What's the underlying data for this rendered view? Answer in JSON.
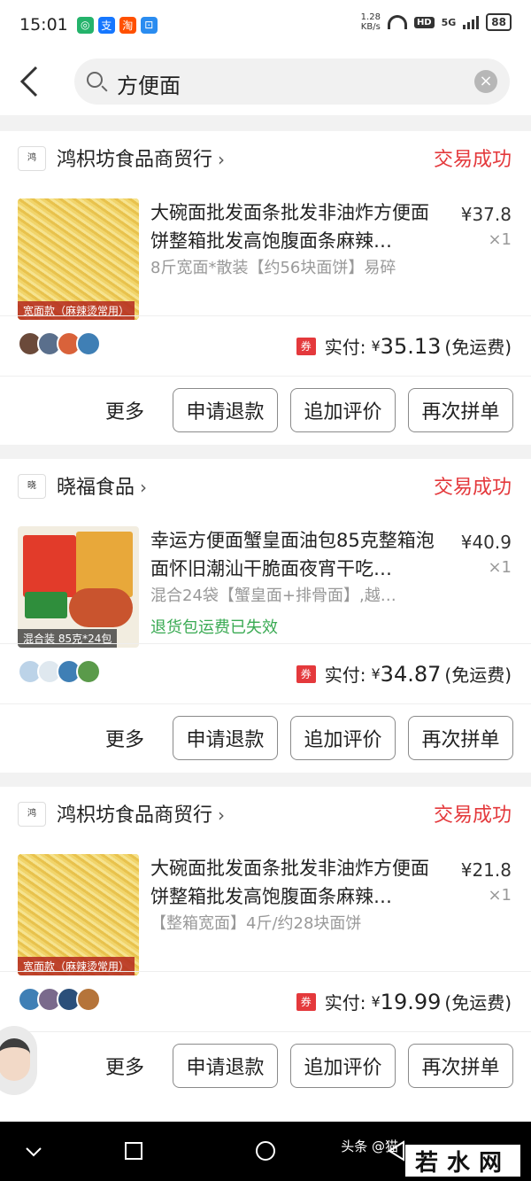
{
  "statusbar": {
    "time": "15:01",
    "apps": [
      {
        "icon": "message-app-icon",
        "glyph": "◎",
        "color": "#24b36b"
      },
      {
        "icon": "alipay-icon",
        "glyph": "支",
        "color": "#1677ff"
      },
      {
        "icon": "taobao-icon",
        "glyph": "淘",
        "color": "#ff5000"
      },
      {
        "icon": "card-app-icon",
        "glyph": "⊡",
        "color": "#2a8cf0"
      }
    ],
    "net_speed_value": "1.28",
    "net_speed_unit": "KB/s",
    "hd_label": "HD",
    "network": "5G",
    "battery": "88"
  },
  "header": {
    "search_query": "方便面",
    "clear_icon": "×"
  },
  "common": {
    "more_label": "更多",
    "refund_label": "申请退款",
    "review_label": "追加评价",
    "reorder_label": "再次拼单",
    "coupon_label": "券",
    "paid_label": "实付:",
    "yen": "¥",
    "shipping": "(免运费)",
    "status": "交易成功",
    "status_color": "#e4393c"
  },
  "orders": [
    {
      "shop": "鸿枳坊食品商贸行",
      "title": "大碗面批发面条批发非油炸方便面饼整箱批发高饱腹面条麻辣…",
      "spec": "8斤宽面*散装【约56块面饼】易碎",
      "note": "",
      "price": "¥37.8",
      "qty": "×1",
      "thumb_tag": "宽面款（麻辣烫常用）",
      "paid": "35.13"
    },
    {
      "shop": "晓福食品",
      "title": "幸运方便面蟹皇面油包85克整箱泡面怀旧潮汕干脆面夜宵干吃…",
      "spec": "混合24袋【蟹皇面+排骨面】,越…",
      "note": "退货包运费已失效",
      "price": "¥40.9",
      "qty": "×1",
      "thumb_tag": "混合装 85克*24包",
      "paid": "34.87"
    },
    {
      "shop": "鸿枳坊食品商贸行",
      "title": "大碗面批发面条批发非油炸方便面饼整箱批发高饱腹面条麻辣…",
      "spec": "【整箱宽面】4斤/约28块面饼",
      "note": "",
      "price": "¥21.8",
      "qty": "×1",
      "thumb_tag": "宽面款（麻辣烫常用）",
      "paid": "19.99"
    }
  ],
  "watermark": {
    "text": "头条 @猫",
    "logo": "若水网"
  }
}
